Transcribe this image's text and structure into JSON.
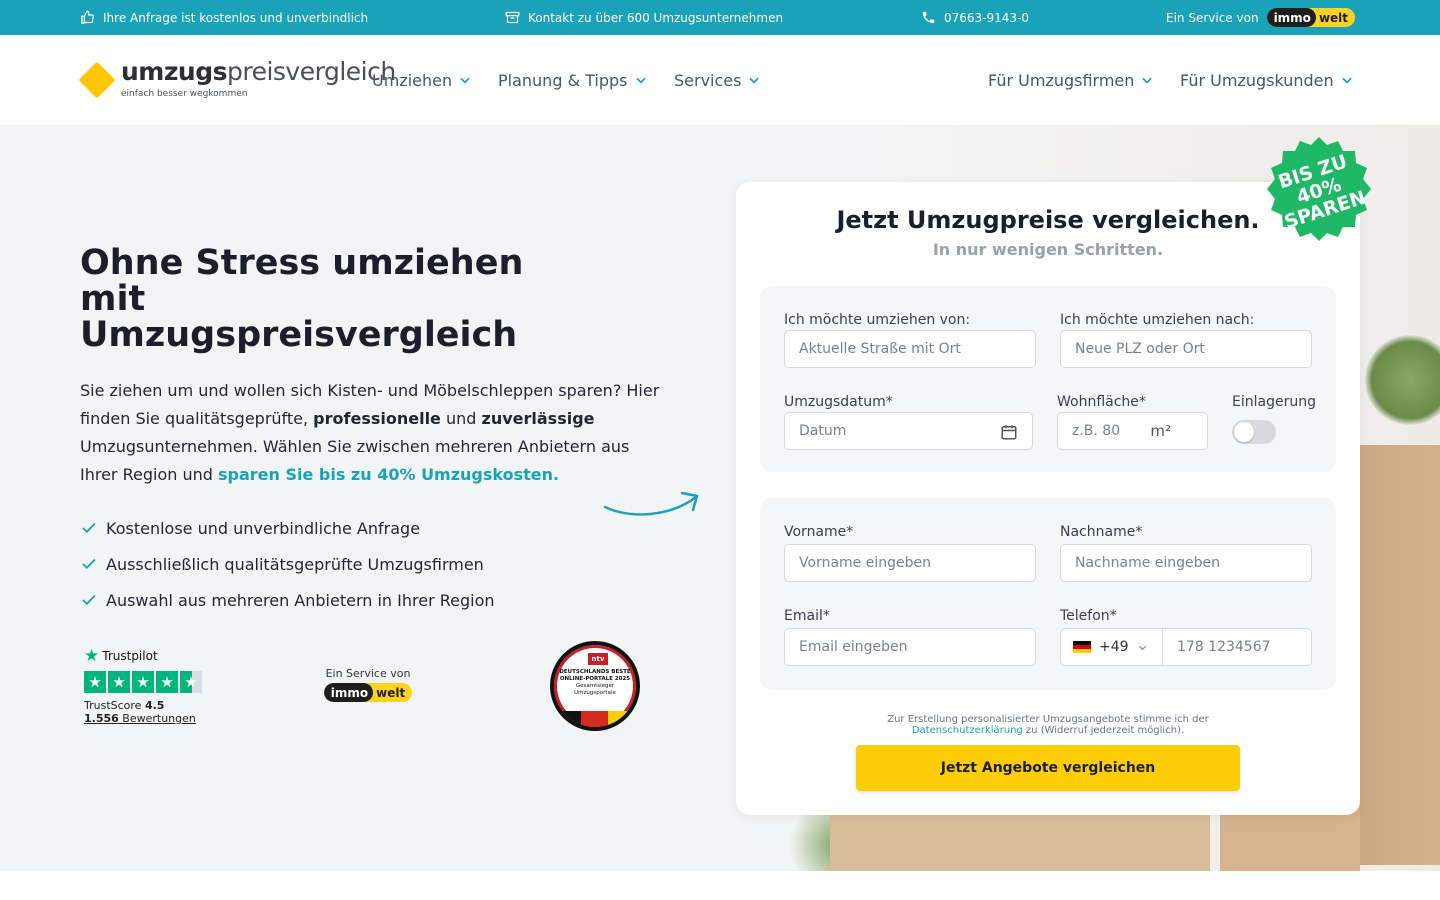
{
  "topbar": {
    "free_text": "Ihre Anfrage ist kostenlos und unverbindlich",
    "contact_text": "Kontakt zu über 600 Umzugsunternehmen",
    "phone": "07663-9143-0",
    "service_text": "Ein Service von",
    "brand_a": "immo",
    "brand_b": "welt"
  },
  "header": {
    "logo_bold": "umzugs",
    "logo_light": "preisvergleich",
    "logo_sub": "einfach besser wegkommen",
    "nav": [
      "Umziehen",
      "Planung & Tipps",
      "Services",
      "Für Umzugsfirmen",
      "Für Umzugskunden"
    ]
  },
  "hero": {
    "title": "Ohne Stress umziehen mit Umzugspreisvergleich",
    "intro_1": "Sie ziehen um und wollen sich Kisten- und Möbelschleppen sparen? Hier finden Sie qualitätsgeprüfte, ",
    "intro_bold_1": "professionelle",
    "intro_2": " und ",
    "intro_bold_2": "zuverlässige",
    "intro_3": " Umzugsunternehmen. Wählen Sie zwischen mehreren Anbietern aus Ihrer Region und ",
    "intro_accent": "sparen Sie bis zu 40% Umzugskosten.",
    "checks": [
      "Kostenlose und unverbindliche Anfrage",
      "Ausschließlich qualitätsgeprüfte Umzugsfirmen",
      "Auswahl aus mehreren Anbietern in Ihrer Region"
    ],
    "trustpilot": {
      "name": "Trustpilot",
      "score_label": "TrustScore",
      "score": "4.5",
      "reviews_count": "1.556",
      "reviews_label": "Bewertungen"
    },
    "service_label": "Ein Service von",
    "seal": {
      "brand": "ntv",
      "title": "DEUTSCHLANDS BESTE ONLINE-PORTALE 2025",
      "line2": "Gesamtsieger",
      "line3": "Umzugsportale"
    }
  },
  "form": {
    "title": "Jetzt Umzugpreise vergleichen.",
    "subtitle": "In nur wenigen Schritten.",
    "badge": "BIS ZU 40% SPAREN",
    "from_label": "Ich möchte umziehen von:",
    "from_placeholder": "Aktuelle Straße mit Ort",
    "to_label": "Ich möchte umziehen nach:",
    "to_placeholder": "Neue PLZ oder Ort",
    "date_label": "Umzugsdatum*",
    "date_placeholder": "Datum",
    "area_label": "Wohnfläche*",
    "area_placeholder": "z.B. 80",
    "area_unit": "m²",
    "storage_label": "Einlagerung",
    "storage_on": false,
    "firstname_label": "Vorname*",
    "firstname_placeholder": "Vorname eingeben",
    "lastname_label": "Nachname*",
    "lastname_placeholder": "Nachname eingeben",
    "email_label": "Email*",
    "email_placeholder": "Email eingeben",
    "phone_label": "Telefon*",
    "phone_prefix": "+49",
    "phone_placeholder": "178 1234567",
    "consent_1": "Zur Erstellung personalisierter Umzugsangebote stimme ich der ",
    "consent_link": "Datenschutzerklärung",
    "consent_2": " zu (Widerruf jederzeit möglich).",
    "submit": "Jetzt Angebote vergleichen"
  },
  "colors": {
    "accent": "#1aa3b8",
    "cta": "#ffcd05",
    "badge": "#1fb866",
    "logo": "#ffc600"
  }
}
